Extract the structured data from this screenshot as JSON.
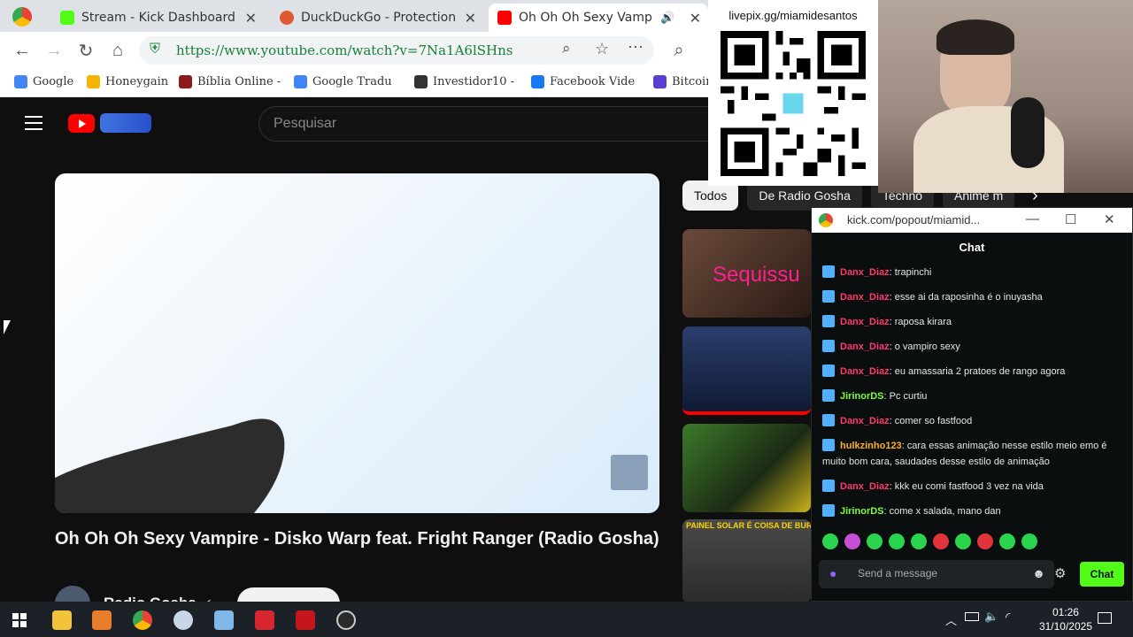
{
  "tabs": [
    {
      "label": "Stream - Kick Dashboard",
      "color": "#53fc18"
    },
    {
      "label": "DuckDuckGo - Protection",
      "color": "#de5833"
    },
    {
      "label": "Oh Oh Oh Sexy Vampir",
      "color": "#ff0000",
      "active": true
    }
  ],
  "address_bar": {
    "url": "https://www.youtube.com/watch?v=7Na1A6lSHns"
  },
  "bookmarks": [
    {
      "label": "Google",
      "icon": "google-icon",
      "color": "#4285f4"
    },
    {
      "label": "Honeygain",
      "icon": "honeygain-icon",
      "color": "#f5b400"
    },
    {
      "label": "Bíblia Online -",
      "icon": "bible-icon",
      "color": "#8b1a1a"
    },
    {
      "label": "Google Tradu",
      "icon": "translate-icon",
      "color": "#4285f4"
    },
    {
      "label": "Investidor10 -",
      "icon": "investidor-icon",
      "color": "#333333"
    },
    {
      "label": "Facebook Vide",
      "icon": "facebook-icon",
      "color": "#1877f2"
    },
    {
      "label": "Bitcoin",
      "icon": "bitcoin-icon",
      "color": "#5b3fd0"
    }
  ],
  "youtube": {
    "search_placeholder": "Pesquisar",
    "video_title": "Oh Oh Oh Sexy Vampire - Disko Warp feat. Fright Ranger (Radio Gosha)",
    "channel_name": "Radio Gosha",
    "chips": [
      "Todos",
      "De Radio Gosha",
      "Techno",
      "Anime m"
    ],
    "thumbnails": [
      {
        "caption": "Sequissu",
        "color": "#3a2a22"
      },
      {
        "caption": "",
        "color": "#1a2a4a"
      },
      {
        "caption": "",
        "color": "#2d5a1d"
      },
      {
        "caption": "PAINEL SOLAR É COISA DE BURGUES",
        "color": "#3a3a3a"
      }
    ]
  },
  "overlay": {
    "qr_caption": "livepix.gg/miamidesantos"
  },
  "chat_window": {
    "url": "kick.com/popout/miamid...",
    "header": "Chat",
    "messages": [
      {
        "user": "Danx_Diaz",
        "text": ": trapinchi",
        "color": "#ff3b6b"
      },
      {
        "user": "Danx_Diaz",
        "text": ": esse ai da raposinha é o inuyasha",
        "color": "#ff3b6b"
      },
      {
        "user": "Danx_Diaz",
        "text": ": raposa kirara",
        "color": "#ff3b6b"
      },
      {
        "user": "Danx_Diaz",
        "text": ": o vampiro sexy",
        "color": "#ff3b6b"
      },
      {
        "user": "Danx_Diaz",
        "text": ": eu amassaria 2 pratoes de rango agora",
        "color": "#ff3b6b"
      },
      {
        "user": "JirinorDS",
        "text": ": Pc curtiu",
        "color": "#7cfc3c"
      },
      {
        "user": "Danx_Diaz",
        "text": ": comer so fastfood",
        "color": "#ff3b6b"
      },
      {
        "user": "hulkzinho123",
        "text": ": cara essas animação nesse estilo meio emo é muito bom cara, saudades desse estilo de animação",
        "color": "#ffb020"
      },
      {
        "user": "Danx_Diaz",
        "text": ": kkk eu comi fastfood 3 vez na vida",
        "color": "#ff3b6b"
      },
      {
        "user": "JirinorDS",
        "text": ": come x salada, mano dan",
        "color": "#7cfc3c"
      }
    ],
    "input_placeholder": "Send a message",
    "send_label": "Chat"
  },
  "taskbar": {
    "time": "01:26",
    "date": "31/10/2025"
  }
}
